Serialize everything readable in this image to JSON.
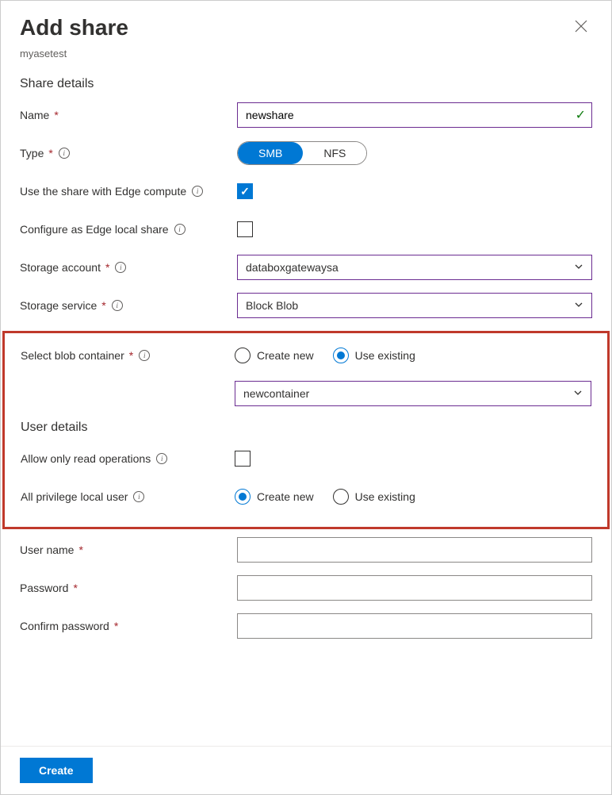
{
  "header": {
    "title": "Add share",
    "subtitle": "myasetest"
  },
  "sections": {
    "shareDetails": "Share details",
    "userDetails": "User details"
  },
  "labels": {
    "name": "Name",
    "type": "Type",
    "edgeCompute": "Use the share with Edge compute",
    "edgeLocal": "Configure as Edge local share",
    "storageAccount": "Storage account",
    "storageService": "Storage service",
    "blobContainer": "Select blob container",
    "readOnly": "Allow only read operations",
    "privUser": "All privilege local user",
    "userName": "User name",
    "password": "Password",
    "confirmPassword": "Confirm password"
  },
  "values": {
    "name": "newshare",
    "storageAccount": "databoxgatewaysa",
    "storageService": "Block Blob",
    "container": "newcontainer",
    "userName": "",
    "password": "",
    "confirmPassword": ""
  },
  "typeOptions": {
    "smb": "SMB",
    "nfs": "NFS"
  },
  "radioOptions": {
    "createNew": "Create new",
    "useExisting": "Use existing"
  },
  "footer": {
    "create": "Create"
  }
}
